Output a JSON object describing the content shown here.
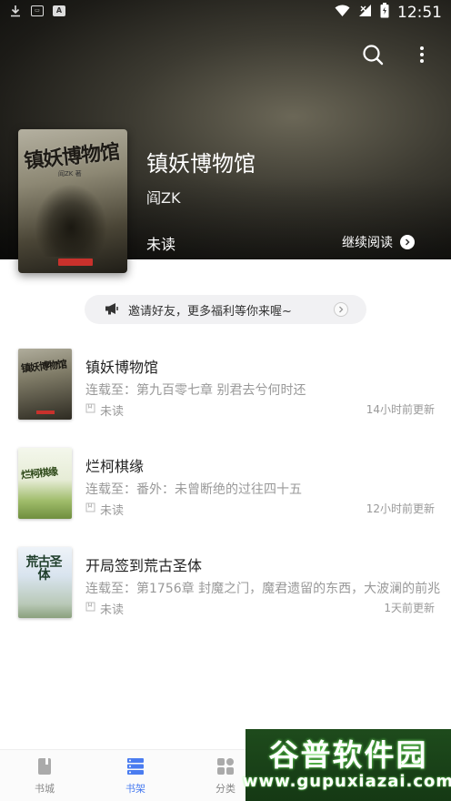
{
  "status_bar": {
    "time": "12:51",
    "icons": [
      "download-icon",
      "app-icon",
      "a-icon",
      "wifi-icon",
      "signal-icon",
      "battery-icon"
    ]
  },
  "header": {
    "icons": [
      "search-icon",
      "more-vertical-icon"
    ],
    "book_title": "镇妖博物馆",
    "author": "阎ZK",
    "read_status": "未读",
    "continue_label": "继续阅读"
  },
  "cover_large": {
    "title_art": "镇妖博物馆",
    "author_art": "阎ZK 著"
  },
  "invite_banner": {
    "text": "邀请好友，更多福利等你来喔~",
    "icon": "megaphone-icon"
  },
  "books": [
    {
      "title": "镇妖博物馆",
      "cover_art": "镇妖博物馆",
      "latest": "连载至：第九百零七章 别君去兮何时还",
      "status": "未读",
      "updated": "14小时前更新"
    },
    {
      "title": "烂柯棋缘",
      "cover_art": "烂柯棋缘",
      "latest": "连载至：番外：未曾断绝的过往四十五",
      "status": "未读",
      "updated": "12小时前更新"
    },
    {
      "title": "开局签到荒古圣体",
      "cover_art": "荒古圣体",
      "latest": "连载至：第1756章 封魔之门，魔君遗留的东西，大波澜的前兆",
      "status": "未读",
      "updated": "1天前更新"
    }
  ],
  "bottom_nav": {
    "items": [
      {
        "label": "书城",
        "icon": "book-icon",
        "active": false
      },
      {
        "label": "书架",
        "icon": "shelf-icon",
        "active": true
      },
      {
        "label": "分类",
        "icon": "grid-icon",
        "active": false
      }
    ],
    "active_color": "#4a7cf0"
  },
  "watermark": {
    "main": "谷普软件园",
    "sub": "www.gupuxiazai.com"
  }
}
